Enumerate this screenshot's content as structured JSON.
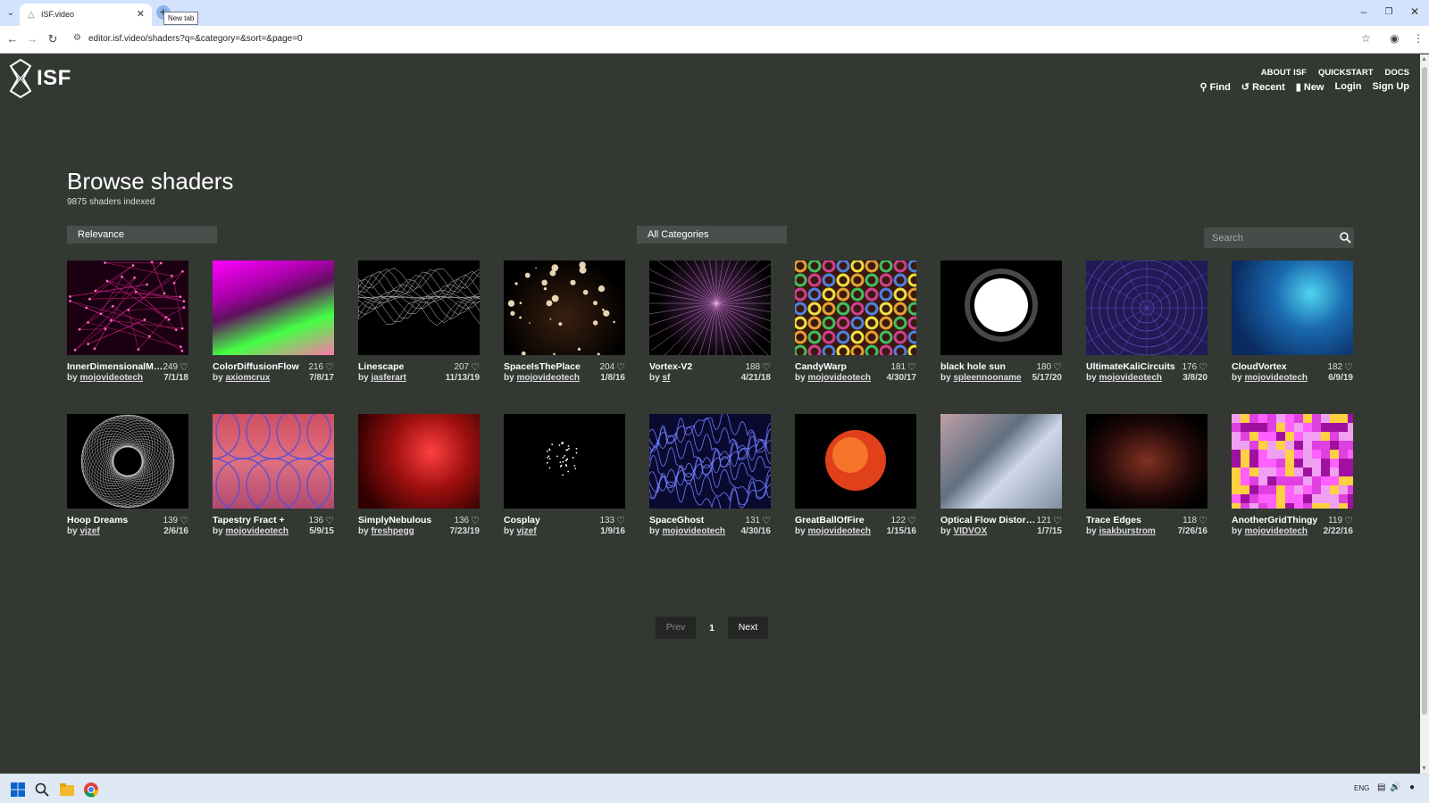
{
  "browser": {
    "tab_title": "ISF.video",
    "tooltip": "New tab",
    "url": "editor.isf.video/shaders?q=&category=&sort=&page=0"
  },
  "site": {
    "logo_text": "ISF",
    "nav_small": [
      "ABOUT ISF",
      "QUICKSTART",
      "DOCS"
    ],
    "nav_main": {
      "find": "Find",
      "recent": "Recent",
      "new": "New",
      "login": "Login",
      "signup": "Sign Up"
    },
    "title": "Browse shaders",
    "subtitle": "9875 shaders indexed",
    "sort_value": "Relevance",
    "category_value": "All Categories",
    "search_placeholder": "Search",
    "by_prefix": "by",
    "shaders": [
      {
        "title": "InnerDimensionalMat...",
        "likes": "249",
        "author": "mojovideotech",
        "date": "7/1/18",
        "art": "constellation"
      },
      {
        "title": "ColorDiffusionFlow",
        "likes": "216",
        "author": "axiomcrux",
        "date": "7/8/17",
        "art": "diffusion"
      },
      {
        "title": "Linescape",
        "likes": "207",
        "author": "jasferart",
        "date": "11/13/19",
        "art": "linescape"
      },
      {
        "title": "SpaceIsThePlace",
        "likes": "204",
        "author": "mojovideotech",
        "date": "1/8/16",
        "art": "space"
      },
      {
        "title": "Vortex-V2",
        "likes": "188",
        "author": "sf",
        "date": "4/21/18",
        "art": "vortex"
      },
      {
        "title": "CandyWarp",
        "likes": "181",
        "author": "mojovideotech",
        "date": "4/30/17",
        "art": "candy"
      },
      {
        "title": "black hole sun",
        "likes": "180",
        "author": "spleennooname",
        "date": "5/17/20",
        "art": "blackhole"
      },
      {
        "title": "UltimateKaliCircuits",
        "likes": "176",
        "author": "mojovideotech",
        "date": "3/8/20",
        "art": "circuits"
      },
      {
        "title": "CloudVortex",
        "likes": "182",
        "author": "mojovideotech",
        "date": "6/9/19",
        "art": "cloud"
      },
      {
        "title": "Hoop Dreams",
        "likes": "139",
        "author": "vjzef",
        "date": "2/6/16",
        "art": "hoop"
      },
      {
        "title": "Tapestry Fract +",
        "likes": "136",
        "author": "mojovideotech",
        "date": "5/9/15",
        "art": "tapestry"
      },
      {
        "title": "SimplyNebulous",
        "likes": "136",
        "author": "freshpegg",
        "date": "7/23/19",
        "art": "nebula"
      },
      {
        "title": "Cosplay",
        "likes": "133",
        "author": "vjzef",
        "date": "1/9/16",
        "art": "cosplay"
      },
      {
        "title": "SpaceGhost",
        "likes": "131",
        "author": "mojovideotech",
        "date": "4/30/16",
        "art": "ghost"
      },
      {
        "title": "GreatBallOfFire",
        "likes": "122",
        "author": "mojovideotech",
        "date": "1/15/16",
        "art": "fireball"
      },
      {
        "title": "Optical Flow Distort.fs",
        "likes": "121",
        "author": "VIDVOX",
        "date": "1/7/15",
        "art": "optical"
      },
      {
        "title": "Trace Edges",
        "likes": "118",
        "author": "isakburstrom",
        "date": "7/26/16",
        "art": "trace"
      },
      {
        "title": "AnotherGridThingy",
        "likes": "119",
        "author": "mojovideotech",
        "date": "2/22/16",
        "art": "grid"
      }
    ],
    "pagination": {
      "prev": "Prev",
      "current": "1",
      "next": "Next"
    }
  },
  "taskbar": {
    "lang": "ENG"
  },
  "colors": {
    "page_bg": "#333833",
    "select_bg": "#4a4f4b",
    "tab_strip": "#d3e3fd"
  }
}
